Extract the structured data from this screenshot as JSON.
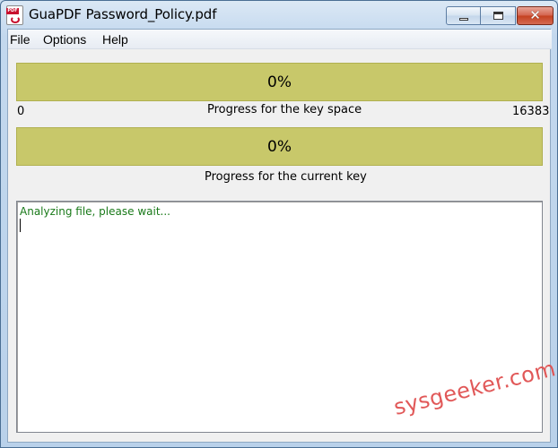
{
  "window": {
    "title": "GuaPDF Password_Policy.pdf",
    "icon": "pdf-icon"
  },
  "menu": {
    "items": [
      {
        "label": "File"
      },
      {
        "label": "Options"
      },
      {
        "label": "Help"
      }
    ]
  },
  "progress_key_space": {
    "percent_text": "0%",
    "value": 0,
    "min_label": "0",
    "max_label": "16383",
    "label": "Progress for the key space"
  },
  "progress_current_key": {
    "percent_text": "0%",
    "value": 0,
    "label": "Progress for the current key"
  },
  "log": {
    "text": "Analyzing file, please wait..."
  },
  "watermark": {
    "text": "sysgeeker.com"
  },
  "colors": {
    "progress_bar": "#c8c86a",
    "log_text": "#1a7a1a",
    "watermark": "#e05050"
  }
}
